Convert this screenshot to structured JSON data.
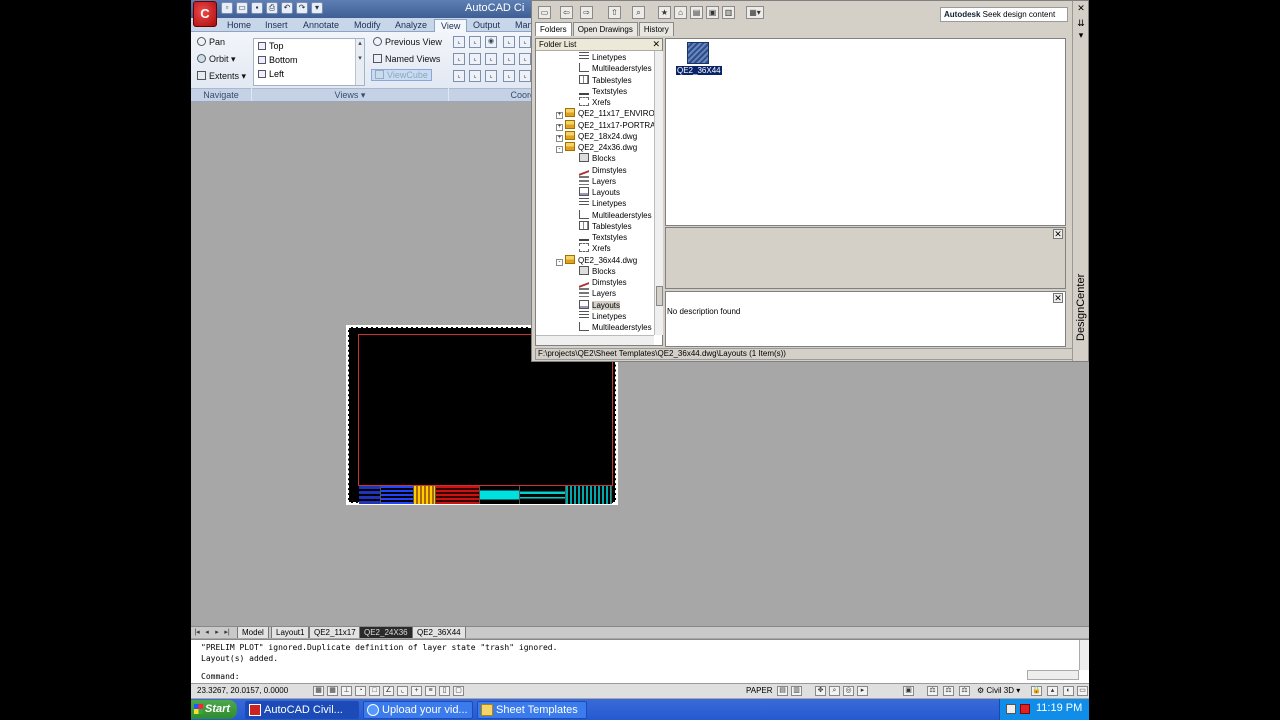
{
  "app": {
    "title": "AutoCAD Ci",
    "logo_letter": "C",
    "ribbon_tabs": [
      "Home",
      "Insert",
      "Annotate",
      "Modify",
      "Analyze",
      "View",
      "Output",
      "Man"
    ],
    "active_tab": "View"
  },
  "ribbon": {
    "navigate": {
      "items": [
        "Pan",
        "Orbit",
        "Extents"
      ],
      "label": "Navigate"
    },
    "views": {
      "list": [
        "Top",
        "Bottom",
        "Left"
      ],
      "buttons": [
        "Previous View",
        "Named Views",
        "ViewCube"
      ],
      "label": "Views"
    },
    "coord_label": "Coord"
  },
  "design_center": {
    "title": "DesignCenter",
    "seek": {
      "brand": "Autodesk",
      "text": " Seek design content"
    },
    "tabs": [
      "Folders",
      "Open Drawings",
      "History"
    ],
    "active_tab": "Folders",
    "folder_list_label": "Folder List",
    "tree": [
      {
        "label": "Linetypes",
        "icon": "linetype-icon",
        "indent": 2
      },
      {
        "label": "Multileaderstyles",
        "icon": "multileader-icon",
        "indent": 2
      },
      {
        "label": "Tablestyles",
        "icon": "table-icon",
        "indent": 2
      },
      {
        "label": "Textstyles",
        "icon": "text-icon",
        "indent": 2
      },
      {
        "label": "Xrefs",
        "icon": "xref-icon",
        "indent": 2
      },
      {
        "label": "QE2_11x17_ENVIRO",
        "icon": "dwg-icon",
        "indent": 1,
        "expander": "+"
      },
      {
        "label": "QE2_11x17-PORTRA",
        "icon": "dwg-icon",
        "indent": 1,
        "expander": "+"
      },
      {
        "label": "QE2_18x24.dwg",
        "icon": "dwg-icon",
        "indent": 1,
        "expander": "+"
      },
      {
        "label": "QE2_24x36.dwg",
        "icon": "dwg-icon",
        "indent": 1,
        "expander": "-"
      },
      {
        "label": "Blocks",
        "icon": "block-icon",
        "indent": 2
      },
      {
        "label": "Dimstyles",
        "icon": "dimstyle-icon",
        "indent": 2
      },
      {
        "label": "Layers",
        "icon": "layer-icon",
        "indent": 2
      },
      {
        "label": "Layouts",
        "icon": "layout-icon",
        "indent": 2
      },
      {
        "label": "Linetypes",
        "icon": "linetype-icon",
        "indent": 2
      },
      {
        "label": "Multileaderstyles",
        "icon": "multileader-icon",
        "indent": 2
      },
      {
        "label": "Tablestyles",
        "icon": "table-icon",
        "indent": 2
      },
      {
        "label": "Textstyles",
        "icon": "text-icon",
        "indent": 2
      },
      {
        "label": "Xrefs",
        "icon": "xref-icon",
        "indent": 2
      },
      {
        "label": "QE2_36x44.dwg",
        "icon": "dwg-icon",
        "indent": 1,
        "expander": "-"
      },
      {
        "label": "Blocks",
        "icon": "block-icon",
        "indent": 2
      },
      {
        "label": "Dimstyles",
        "icon": "dimstyle-icon",
        "indent": 2
      },
      {
        "label": "Layers",
        "icon": "layer-icon",
        "indent": 2
      },
      {
        "label": "Layouts",
        "icon": "layout-icon",
        "indent": 2,
        "selected": true
      },
      {
        "label": "Linetypes",
        "icon": "linetype-icon",
        "indent": 2
      },
      {
        "label": "Multileaderstyles",
        "icon": "multileader-icon",
        "indent": 2
      }
    ],
    "content_item": "QE2_36X44",
    "description": "No description found",
    "status_path": "F:\\projects\\QE2\\Sheet Templates\\QE2_36x44.dwg\\Layouts (1 Item(s))"
  },
  "layout_tabs": [
    "Model",
    "Layout1",
    "QE2_11x17",
    "QE2_24X36",
    "QE2_36X44"
  ],
  "active_layout": "QE2_24X36",
  "command": {
    "line1": "\"PRELIM PLOT\" ignored.Duplicate definition of layer state \"trash\" ignored.",
    "line2": "Layout(s) added.",
    "prompt": "Command:"
  },
  "status": {
    "coords": "23.3267, 20.0157, 0.0000",
    "paper": "PAPER",
    "workspace": "Civil 3D"
  },
  "taskbar": {
    "start": "Start",
    "tasks": [
      "AutoCAD Civil...",
      "Upload your vid...",
      "Sheet Templates"
    ],
    "active_task": 0,
    "clock": "11:19 PM"
  },
  "colors": {
    "title_blue": "#3f5f94",
    "selection": "#0a246a",
    "sheet_frame": "#cc3333"
  }
}
